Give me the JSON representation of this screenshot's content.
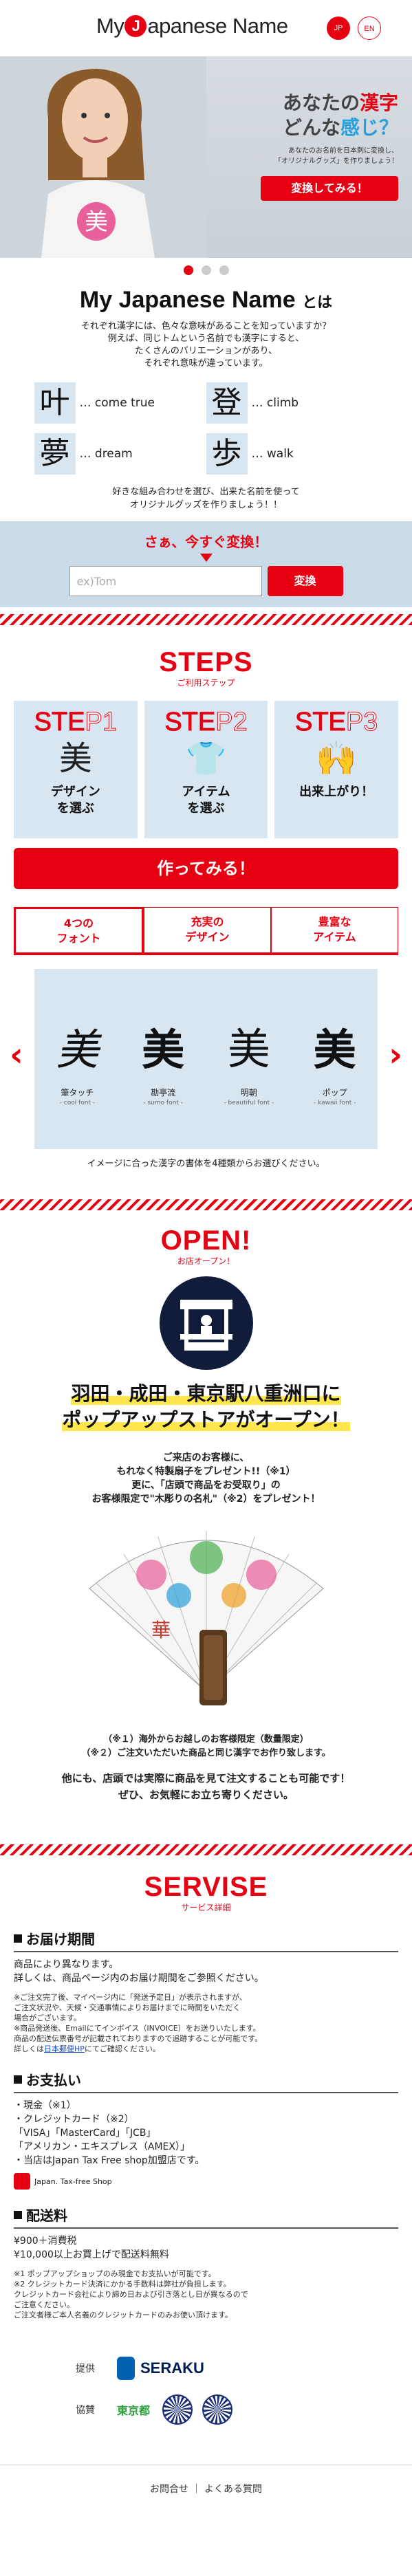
{
  "header": {
    "logo_pre": "My",
    "logo_icon": "J",
    "logo_post": "apanese Name",
    "lang_jp": "JP",
    "lang_en": "EN"
  },
  "hero": {
    "title_part1": "あなたの",
    "title_kanji": "漢字",
    "title_part2": "どんな",
    "title_kanji2": "感じ",
    "title_part3": "？",
    "sub1": "あなたのお名前を日本刺に変換し、",
    "sub2": "「オリジナルグッズ」を作りましょう！",
    "cta": "変換してみる！",
    "shirt_text": "美"
  },
  "intro": {
    "title_main": "My Japanese Name",
    "title_suffix": "とは",
    "lines": [
      "それぞれ漢字には、色々な意味があることを知っていますか？",
      "例えば、同じトムという名前でも漢字にすると、",
      "たくさんのバリエーションがあり、",
      "それぞれ意味が違っています。"
    ],
    "examples": [
      {
        "kanji": "叶",
        "meaning": "… come true"
      },
      {
        "kanji": "登",
        "meaning": "… climb"
      },
      {
        "kanji": "夢",
        "meaning": "… dream"
      },
      {
        "kanji": "歩",
        "meaning": "… walk"
      }
    ],
    "lines2": [
      "好きな組み合わせを選び、出来た名前を使って",
      "オリジナルグッズを作りましょう！！"
    ]
  },
  "try": {
    "title": "さぁ、今すぐ変換！",
    "placeholder": "ex)Tom",
    "button": "変換"
  },
  "steps": {
    "heading_en": "STEPS",
    "heading_jp": "ご利用ステップ",
    "items": [
      {
        "label_a": "STE",
        "label_b": "P1",
        "icon": "美",
        "text1": "デザイン",
        "text2": "を選ぶ"
      },
      {
        "label_a": "STE",
        "label_b": "P2",
        "icon": "👕",
        "text1": "アイテム",
        "text2": "を選ぶ"
      },
      {
        "label_a": "STE",
        "label_b": "P3",
        "icon": "🙌",
        "text1": "出来上がり！",
        "text2": ""
      }
    ],
    "make_button": "作ってみる！"
  },
  "features": {
    "tabs": [
      {
        "line1": "4つの",
        "line2": "フォント"
      },
      {
        "line1": "充実の",
        "line2": "デザイン"
      },
      {
        "line1": "豊富な",
        "line2": "アイテム"
      }
    ],
    "fonts": [
      {
        "glyph": "美",
        "name": "筆タッチ",
        "sub": "- cool font -"
      },
      {
        "glyph": "美",
        "name": "勘亭流",
        "sub": "- sumo font -"
      },
      {
        "glyph": "美",
        "name": "明朝",
        "sub": "- beautiful font -"
      },
      {
        "glyph": "美",
        "name": "ポップ",
        "sub": "- kawaii font -"
      }
    ],
    "caption": "イメージに合った漢字の書体を4種類からお選びください。"
  },
  "open": {
    "heading_en": "OPEN!",
    "heading_jp": "お店オープン！",
    "title_line1": "羽田・成田・東京駅八重洲口に",
    "title_line2": "ポップアップストアがオープン！",
    "text": [
      "ご来店のお客様に、",
      "もれなく特製扇子をプレゼント!!（※1）",
      "更に、「店頭で商品をお受取り」の",
      "お客様限定で\"木彫りの名札\"（※2）をプレゼント！"
    ],
    "fan_text": "華",
    "notes": [
      "（※１）海外からお越しのお客様限定（数量限定）",
      "（※２）ご注文いただいた商品と同じ漢字でお作り致します。"
    ],
    "note_bottom": [
      "他にも、店頭では実際に商品を見て注文することも可能です！",
      "ぜひ、お気軽にお立ち寄りください。"
    ]
  },
  "service": {
    "heading_en": "SERVISE",
    "heading_jp": "サービス詳細",
    "delivery": {
      "title": "お届け期間",
      "body": [
        "商品により異なります。",
        "詳しくは、商品ページ内のお届け期間をご参照ください。"
      ],
      "small": [
        "※ご注文完了後、マイページ内に「発送予定日」が表示されますが、",
        "ご注文状況や、天候・交通事情によりお届けまでに時間をいただく",
        "場合がございます。",
        "※商品発送後、Emailにてインボイス（INVOICE）をお送りいたします。",
        "商品の配送伝票番号が記載されておりますので追跡することが可能です。",
        "詳しくは"
      ],
      "link": "日本郵便HP",
      "link_after": "にてご確認ください。"
    },
    "payment": {
      "title": "お支払い",
      "items": [
        "・現金（※1）",
        "・クレジットカード（※2）",
        "「VISA」「MasterCard」「JCB」",
        "「アメリカン・エキスプレス（AMEX）」",
        "・当店はJapan Tax Free shop加盟店です。"
      ],
      "taxfree": "Japan. Tax-free Shop"
    },
    "shipping": {
      "title": "配送料",
      "items": [
        "¥900＋消費税",
        "¥10,000以上お買上げで配送料無料"
      ],
      "small": [
        "※1 ポップアップショップのみ現金でお支払いが可能です。",
        "※2 クレジットカード決済にかかる手数料は弊社が負担します。",
        "クレジットカード会社により締め日および引き落とし日が異なるので",
        "ご注意ください。",
        "ご注文者様ご本人名義のクレジットカードのみお使い頂けます。"
      ]
    }
  },
  "sponsors": {
    "provided_label": "提供",
    "provided_name": "SERAKU",
    "support_label": "協賛",
    "tokyo": "東京都"
  },
  "footer": {
    "contact": "お問合せ",
    "sep": "｜",
    "faq": "よくある質問"
  },
  "colors": {
    "accent": "#e60012",
    "light_blue": "#d7e6f1",
    "band_blue": "#c9dbe8",
    "navy": "#111c3a"
  }
}
